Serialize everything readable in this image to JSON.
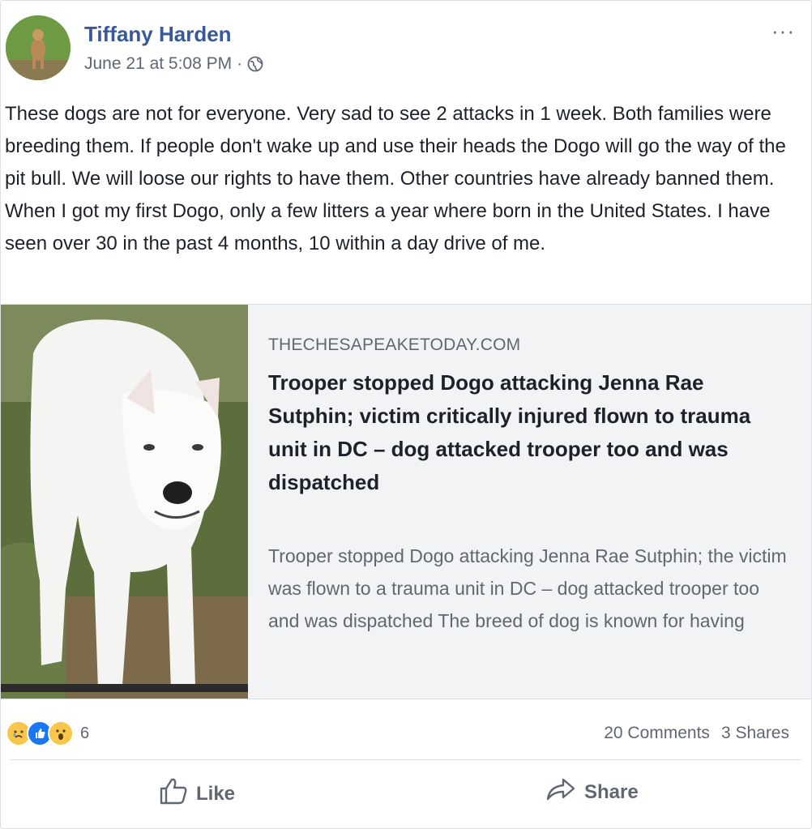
{
  "post": {
    "author": "Tiffany Harden",
    "timestamp": "June 21 at 5:08 PM",
    "separator": "·",
    "privacy_icon": "globe-icon",
    "more_label": "···",
    "text": "These dogs are not for everyone. Very sad to see 2 attacks in 1 week. Both families were breeding them. If people don't wake up and use their heads the Dogo will go the way of the pit bull. We will loose our rights to have them. Other countries have already banned them. When I got my first Dogo, only a few litters a year where born in the United States. I have seen over 30 in the past 4 months, 10 within a day drive of me."
  },
  "link": {
    "domain": "THECHESAPEAKETODAY.COM",
    "headline": "Trooper stopped Dogo attacking Jenna Rae Sutphin; victim critically injured flown to trauma unit in DC – dog attacked trooper too and was dispatched",
    "description": "Trooper stopped Dogo attacking Jenna Rae Sutphin; the victim was flown to a trauma unit in DC – dog attacked trooper too and was dispatched The breed of dog is known for having"
  },
  "footer": {
    "reaction_icons": [
      "sad-icon",
      "like-icon",
      "wow-icon"
    ],
    "reaction_count": "6",
    "comments": "20 Comments",
    "shares": "3 Shares",
    "like_label": "Like",
    "share_label": "Share"
  },
  "colors": {
    "author": "#385898",
    "link_bg": "#f2f3f5",
    "secondary_text": "#606770",
    "like_blue": "#1877f2",
    "emoji_yellow": "#f7c64a"
  }
}
